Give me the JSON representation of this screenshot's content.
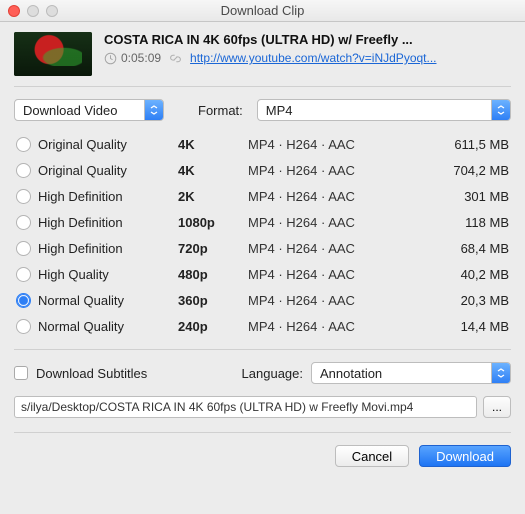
{
  "window": {
    "title": "Download Clip"
  },
  "video": {
    "title": "COSTA RICA IN 4K 60fps (ULTRA HD) w/ Freefly ...",
    "duration": "0:05:09",
    "url": "http://www.youtube.com/watch?v=iNJdPyoqt..."
  },
  "controls": {
    "download_mode": "Download Video",
    "format_label": "Format:",
    "format_value": "MP4"
  },
  "options": [
    {
      "quality": "Original Quality",
      "res": "4K",
      "codec": "MP4 · H264 · AAC",
      "size": "611,5 MB",
      "selected": false
    },
    {
      "quality": "Original Quality",
      "res": "4K",
      "codec": "MP4 · H264 · AAC",
      "size": "704,2 MB",
      "selected": false
    },
    {
      "quality": "High Definition",
      "res": "2K",
      "codec": "MP4 · H264 · AAC",
      "size": "301 MB",
      "selected": false
    },
    {
      "quality": "High Definition",
      "res": "1080p",
      "codec": "MP4 · H264 · AAC",
      "size": "118 MB",
      "selected": false
    },
    {
      "quality": "High Definition",
      "res": "720p",
      "codec": "MP4 · H264 · AAC",
      "size": "68,4 MB",
      "selected": false
    },
    {
      "quality": "High Quality",
      "res": "480p",
      "codec": "MP4 · H264 · AAC",
      "size": "40,2 MB",
      "selected": false
    },
    {
      "quality": "Normal Quality",
      "res": "360p",
      "codec": "MP4 · H264 · AAC",
      "size": "20,3 MB",
      "selected": true
    },
    {
      "quality": "Normal Quality",
      "res": "240p",
      "codec": "MP4 · H264 · AAC",
      "size": "14,4 MB",
      "selected": false
    }
  ],
  "subs": {
    "checkbox_label": "Download Subtitles",
    "checked": false,
    "language_label": "Language:",
    "language_value": "Annotation"
  },
  "path": {
    "value": "s/ilya/Desktop/COSTA RICA IN 4K 60fps (ULTRA HD) w  Freefly Movi.mp4",
    "browse": "..."
  },
  "buttons": {
    "cancel": "Cancel",
    "download": "Download"
  }
}
